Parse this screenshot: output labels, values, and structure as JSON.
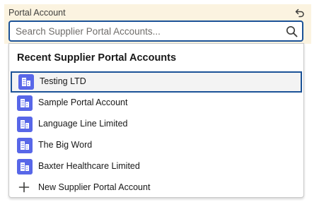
{
  "field": {
    "label": "Portal Account",
    "undo_icon": "undo-icon"
  },
  "search": {
    "placeholder": "Search Supplier Portal Accounts...",
    "value": "",
    "icon": "search-icon"
  },
  "dropdown": {
    "heading": "Recent Supplier Portal Accounts",
    "items": [
      {
        "label": "Testing LTD",
        "icon": "building-icon",
        "highlighted": true
      },
      {
        "label": "Sample Portal Account",
        "icon": "building-icon"
      },
      {
        "label": "Language Line Limited",
        "icon": "building-icon"
      },
      {
        "label": "The Big Word",
        "icon": "building-icon"
      },
      {
        "label": "Baxter Healthcare Limited",
        "icon": "building-icon"
      }
    ],
    "new_action": {
      "label": "New Supplier Portal Account",
      "icon": "plus-icon"
    }
  },
  "colors": {
    "accent": "#1b5297",
    "record_icon": "#5867e8",
    "label_band": "#fbf3e0"
  }
}
